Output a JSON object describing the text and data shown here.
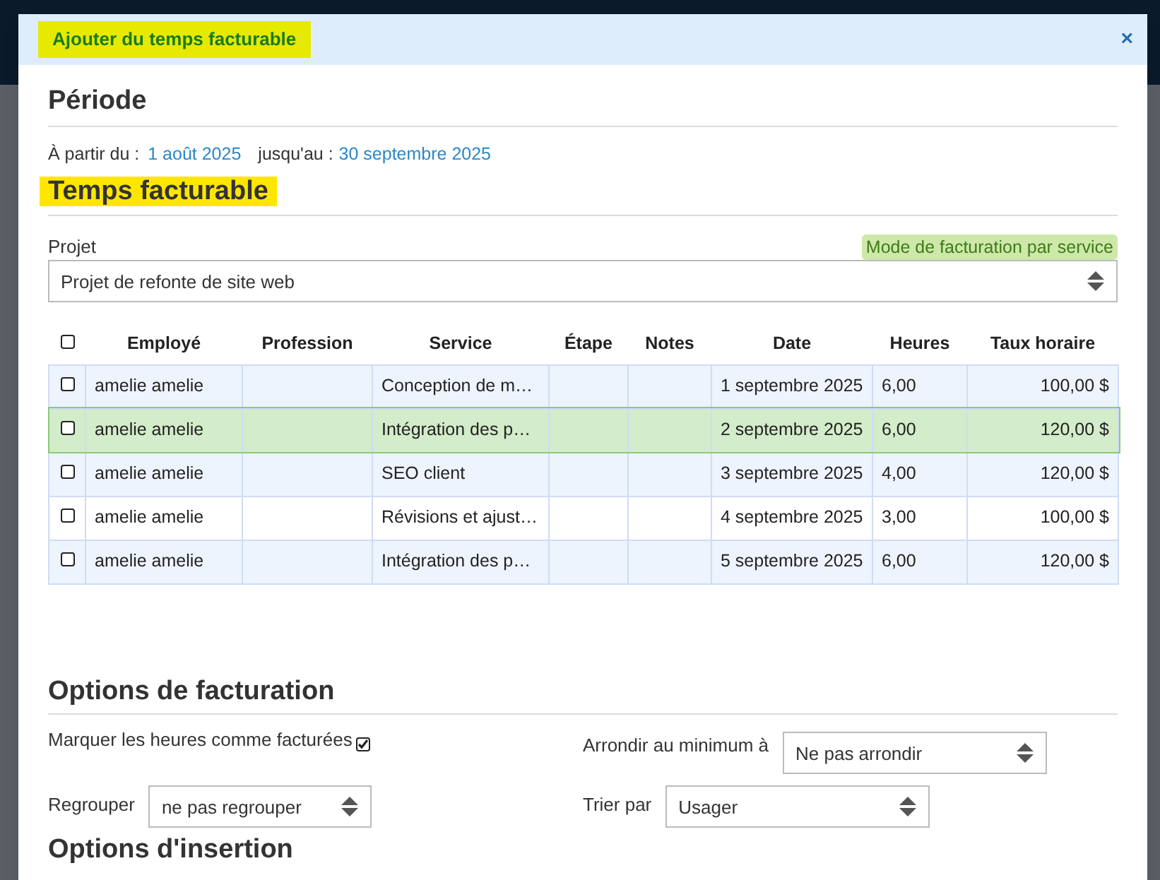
{
  "dialog": {
    "title": "Ajouter du temps facturable",
    "close": "×"
  },
  "periode": {
    "heading": "Période",
    "from_label": "À partir du :",
    "from": "1 août 2025",
    "to_label": "jusqu'au :",
    "to": "30 septembre 2025"
  },
  "temps": {
    "heading": "Temps facturable",
    "project_label": "Projet",
    "mode_badge": "Mode de facturation par service",
    "project": "Projet de refonte de site web"
  },
  "table": {
    "header_checked": false,
    "columns": [
      "Employé",
      "Profession",
      "Service",
      "Étape",
      "Notes",
      "Date",
      "Heures",
      "Taux horaire"
    ],
    "rows": [
      {
        "checked": false,
        "selected": false,
        "cells": [
          "amelie amelie",
          "",
          "Conception de m…",
          "",
          "",
          "1 septembre 2025",
          "6,00",
          "100,00 $"
        ]
      },
      {
        "checked": false,
        "selected": true,
        "cells": [
          "amelie amelie",
          "",
          "Intégration des p…",
          "",
          "",
          "2 septembre 2025",
          "6,00",
          "120,00 $"
        ]
      },
      {
        "checked": false,
        "selected": false,
        "cells": [
          "amelie amelie",
          "",
          "SEO client",
          "",
          "",
          "3 septembre 2025",
          "4,00",
          "120,00 $"
        ]
      },
      {
        "checked": false,
        "selected": false,
        "cells": [
          "amelie amelie",
          "",
          "Révisions et ajust…",
          "",
          "",
          "4 septembre 2025",
          "3,00",
          "100,00 $"
        ]
      },
      {
        "checked": false,
        "selected": false,
        "cells": [
          "amelie amelie",
          "",
          "Intégration des p…",
          "",
          "",
          "5 septembre 2025",
          "6,00",
          "120,00 $"
        ]
      }
    ]
  },
  "facturation": {
    "heading": "Options de facturation",
    "mark_label": "Marquer les heures comme facturées",
    "mark_checked": true,
    "round_label": "Arrondir au minimum à",
    "round": "Ne pas arrondir",
    "group_label": "Regrouper",
    "group": "ne pas regrouper",
    "sort_label": "Trier par",
    "sort": "Usager"
  },
  "insertion": {
    "heading": "Options d'insertion"
  }
}
